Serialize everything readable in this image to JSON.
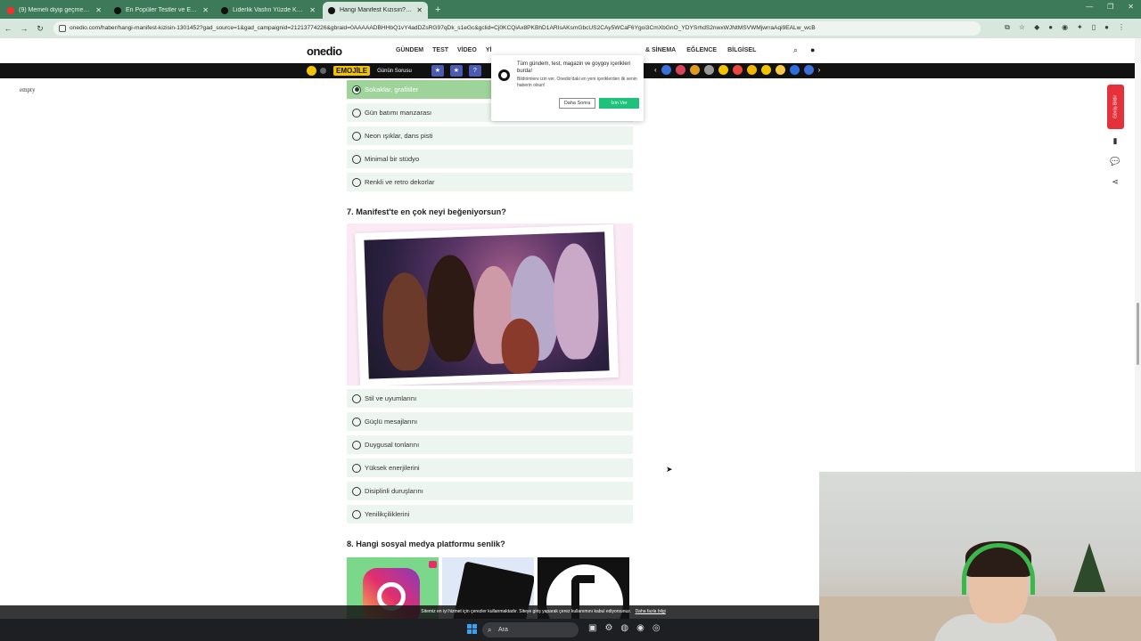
{
  "browser": {
    "tabs": [
      {
        "title": "(9) Memeli diyip geçmeyin... - A",
        "favicon_color": "#ff2b2b",
        "active": false
      },
      {
        "title": "En Popüler Testler ve Eğlenceli",
        "favicon_color": "#111111",
        "active": false
      },
      {
        "title": "Liderlik Vasfın Yüzde Kaç? - Onl",
        "favicon_color": "#111111",
        "active": false
      },
      {
        "title": "Hangi Manifest Kızısın? - Oned",
        "favicon_color": "#111111",
        "active": true
      }
    ],
    "url": "onedio.com/haber/hangi-manifest-kizisin-1301452?gad_source=1&gad_campaignid=21213774226&gbraid=0AAAAADBHHbQ1vY4adDZsRG97qDk_s1eGc&gclid=Cj0KCQiAx8PKBhD1ARIsAKsmGbcUS2CAy5WCaF6Ygoi3CmXbGnO_YDYSrhdS2nwxWJNtMSVWMjwrraAqi9EALw_wcB"
  },
  "site": {
    "logo": "onedio",
    "nav_left": [
      "GÜNDEM",
      "TEST",
      "VİDEO",
      "Yİ"
    ],
    "nav_right": [
      "& SİNEMA",
      "EĞLENCE",
      "BİLGİSEL"
    ],
    "strip": {
      "brand": "EMOJİLE",
      "daily": "Günün Sorusu"
    }
  },
  "left_text": "empty",
  "quiz": {
    "q6_options": [
      {
        "label": "Sokaklar, grafitiler",
        "selected": true
      },
      {
        "label": "Gün batımı manzarası",
        "selected": false
      },
      {
        "label": "Neon ışıklar, dans pisti",
        "selected": false
      },
      {
        "label": "Minimal bir stüdyo",
        "selected": false
      },
      {
        "label": "Renkli ve retro dekorlar",
        "selected": false
      }
    ],
    "q7": {
      "title": "7. Manifest'te en çok neyi beğeniyorsun?",
      "options": [
        "Stil ve uyumlarını",
        "Güçlü mesajlarını",
        "Duygusal tonlarını",
        "Yüksek enerjilerini",
        "Disiplinli duruşlarını",
        "Yenilikçiliklerini"
      ]
    },
    "q8": {
      "title": "8. Hangi sosyal medya platformu senlik?"
    }
  },
  "notification": {
    "title": "Tüm gündem, test, magazin ve goygoy içerikleri burda!",
    "body": "Bildirimlere izin ver, Onedio'daki en yeni içeriklerden ilk senin haberin olsun!",
    "later": "Daha Sonra",
    "allow": "İzin Ver"
  },
  "side": {
    "feedback": "Görüş Bildir"
  },
  "cookie": {
    "text": "Sitemiz en iyi hizmet için çerezler kullanmaktadır. Siteye giriş yaparak çerez kullanımını kabul ediyorsunuz.",
    "link": "Daha fazla bilgi"
  },
  "taskbar": {
    "search": "Ara"
  }
}
